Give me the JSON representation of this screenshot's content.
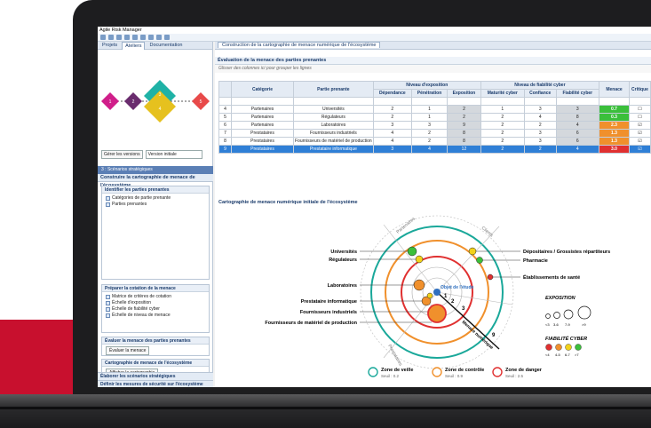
{
  "app": {
    "title": "Agile Risk Manager"
  },
  "left": {
    "tabs": [
      "Projets",
      "Ateliers",
      "Documentation"
    ],
    "versions_button": "Gérer les versions",
    "version_select": "Version initiale",
    "scenarios_tab": "3 : Scénarios stratégiques",
    "build_title": "Construire la cartographie de menace de l'écosystème",
    "sections": {
      "identify": {
        "title": "Identifier les parties prenantes",
        "items": [
          "Catégories de partie prenante",
          "Parties prenantes"
        ]
      },
      "prepare": {
        "title": "Préparer la cotation de la menace",
        "items": [
          "Matrice de critères de cotation",
          "Échelle d'exposition",
          "Échelle de fiabilité cyber",
          "Échelle de niveau de menace"
        ]
      },
      "evaluate": {
        "title": "Évaluer la menace des parties prenantes",
        "button": "Évaluer la menace"
      },
      "map": {
        "title": "Cartographie de menace de l'écosystème",
        "button": "Afficher la cartographie"
      }
    },
    "bottom": [
      "Élaborer les scénarios stratégiques",
      "Définir les mesures de sécurité sur l'écosystème"
    ],
    "diagram_nodes": [
      "1",
      "2",
      "3",
      "4",
      "5"
    ]
  },
  "editor": {
    "tab": "Construction de la cartographie de menace numérique de l'écosystème",
    "section": "Évaluation de la menace des parties prenantes",
    "hint": "Glisser des colonnes ici pour grouper les lignes",
    "headers": {
      "categorie": "Catégorie",
      "partie": "Partie prenante",
      "group_expo": "Niveau d'exposition",
      "group_fiab": "Niveau de fiabilité cyber",
      "dependance": "Dépendance",
      "penetration": "Pénétration",
      "exposition": "Exposition",
      "maturite": "Maturité cyber",
      "confiance": "Confiance",
      "fiabilite": "Fiabilité cyber",
      "menace": "Menace",
      "critique": "Critique"
    },
    "rows": [
      {
        "n": "4",
        "cat": "Partenaires",
        "pp": "Universités",
        "dep": "2",
        "pen": "1",
        "exp": "2",
        "mat": "1",
        "con": "3",
        "fia": "3",
        "men": "0.7",
        "menColor": "#3bbf3b",
        "crit": "☐"
      },
      {
        "n": "5",
        "cat": "Partenaires",
        "pp": "Régulateurs",
        "dep": "2",
        "pen": "1",
        "exp": "2",
        "mat": "2",
        "con": "4",
        "fia": "8",
        "men": "0.3",
        "menColor": "#3bbf3b",
        "crit": "☐"
      },
      {
        "n": "6",
        "cat": "Partenaires",
        "pp": "Laboratoires",
        "dep": "3",
        "pen": "3",
        "exp": "9",
        "mat": "2",
        "con": "2",
        "fia": "4",
        "men": "2.3",
        "menColor": "#f0902c",
        "crit": "☑"
      },
      {
        "n": "7",
        "cat": "Prestataires",
        "pp": "Fournisseurs industriels",
        "dep": "4",
        "pen": "2",
        "exp": "8",
        "mat": "2",
        "con": "3",
        "fia": "6",
        "men": "1.3",
        "menColor": "#f0902c",
        "crit": "☑"
      },
      {
        "n": "8",
        "cat": "Prestataires",
        "pp": "Fournisseurs de matériel de production",
        "dep": "4",
        "pen": "2",
        "exp": "8",
        "mat": "2",
        "con": "3",
        "fia": "6",
        "men": "1.3",
        "menColor": "#f0902c",
        "crit": "☑"
      },
      {
        "n": "9",
        "cat": "Prestataires",
        "pp": "Prestataire informatique",
        "dep": "3",
        "pen": "4",
        "exp": "12",
        "mat": "2",
        "con": "2",
        "fia": "4",
        "men": "3.0",
        "menColor": "#e03030",
        "crit": "☑",
        "sel": true
      }
    ],
    "chart_title": "Cartographie de menace numérique initiale de l'écosystème"
  },
  "chart": {
    "left_labels": [
      "Universités",
      "Régulateurs",
      "Laboratoires",
      "Prestataire informatique",
      "Fournisseurs industriels",
      "Fournisseurs de matériel de production"
    ],
    "right_labels": [
      "Dépositaires / Grossistes répartiteurs",
      "Pharmacie",
      "Établissements de santé"
    ],
    "center": "Objet de l'étude",
    "ring_numbers": [
      "9",
      "3",
      "2",
      "1"
    ],
    "axis_label": "Menace numérique",
    "arc_labels": [
      "Partenaires",
      "Clients",
      "Prestataires"
    ],
    "exposition_title": "EXPOSITION",
    "exposition_scale": [
      "<3",
      "3-6",
      "7-9",
      ">9"
    ],
    "fiabilite_title": "FIABILITÉ CYBER",
    "fiabilite_scale": [
      "<4",
      "4-5",
      "6-7",
      ">7"
    ],
    "fiabilite_colors": [
      "#e03030",
      "#f0902c",
      "#f2d21a",
      "#3bbf3b"
    ],
    "zones": [
      {
        "name": "Zone de veille",
        "seuil": "Seuil : 0.2",
        "color": "#1aa89a"
      },
      {
        "name": "Zone de contrôle",
        "seuil": "Seuil : 0.9",
        "color": "#f0902c"
      },
      {
        "name": "Zone de danger",
        "seuil": "Seuil : 2.5",
        "color": "#e03030"
      }
    ]
  }
}
